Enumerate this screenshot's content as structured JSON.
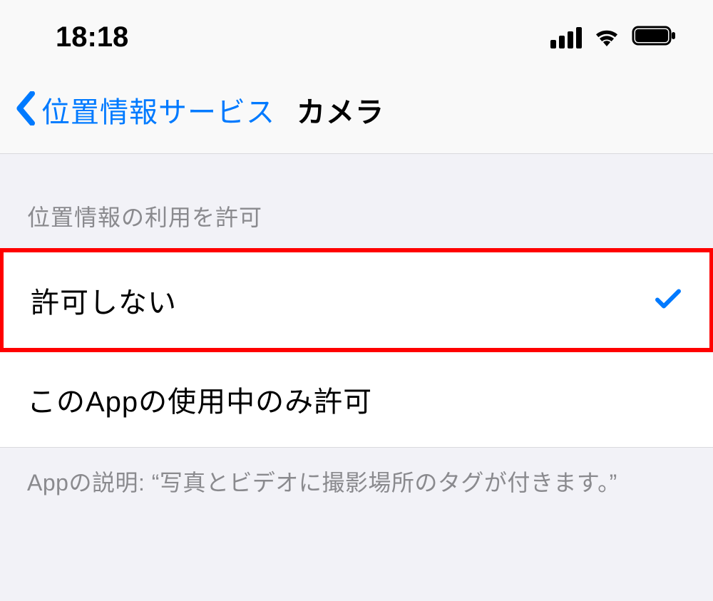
{
  "status_bar": {
    "time": "18:18"
  },
  "nav": {
    "back_label": "位置情報サービス",
    "title": "カメラ"
  },
  "section": {
    "header": "位置情報の利用を許可",
    "footer": "Appの説明: “写真とビデオに撮影場所のタグが付きます。”"
  },
  "options": {
    "never": "許可しない",
    "while_using": "このAppの使用中のみ許可"
  },
  "selected_option": "never"
}
